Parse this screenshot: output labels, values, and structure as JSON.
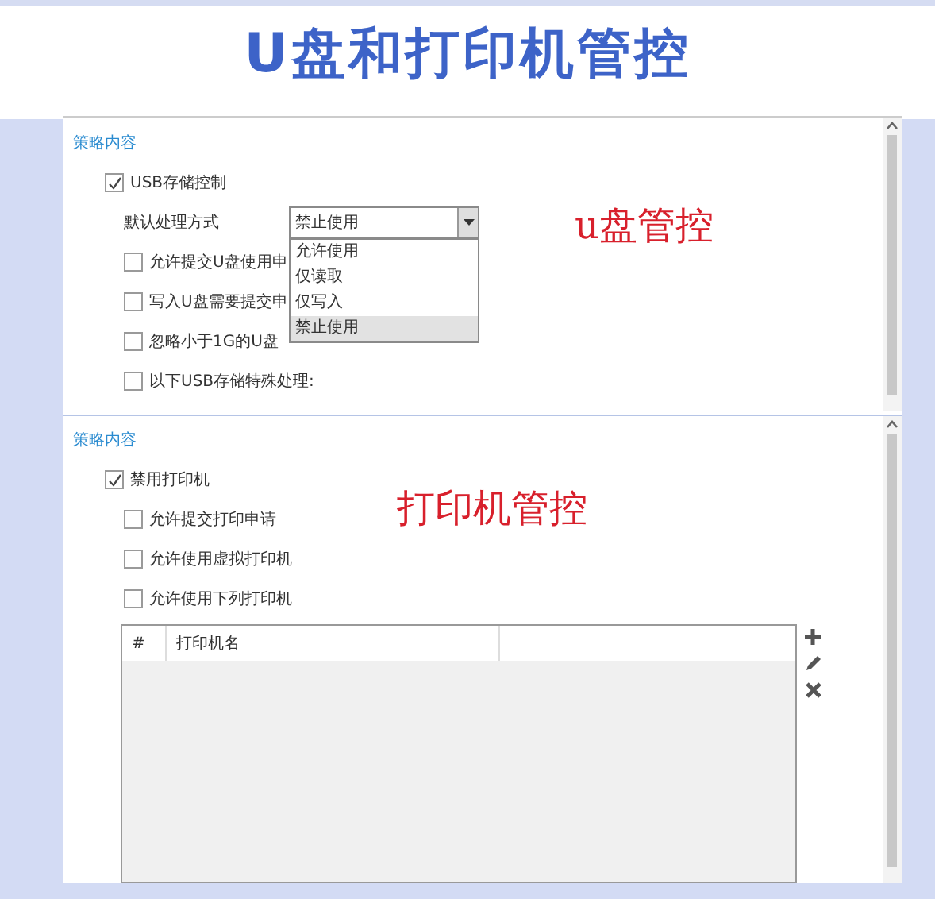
{
  "title": "U盘和打印机管控",
  "usb_panel": {
    "section_title": "策略内容",
    "main_option": {
      "label": "USB存储控制",
      "checked": true
    },
    "default_action": {
      "label": "默认处理方式",
      "value": "禁止使用",
      "expanded": true,
      "options": [
        {
          "label": "允许使用",
          "selected": false
        },
        {
          "label": "仅读取",
          "selected": false
        },
        {
          "label": "仅写入",
          "selected": false
        },
        {
          "label": "禁止使用",
          "selected": true
        }
      ]
    },
    "options": [
      {
        "label": "允许提交U盘使用申",
        "checked": false
      },
      {
        "label": "写入U盘需要提交申",
        "checked": false
      },
      {
        "label": "忽略小于1G的U盘",
        "checked": false
      },
      {
        "label": "以下USB存储特殊处理:",
        "checked": false
      }
    ],
    "annotation": "u盘管控"
  },
  "printer_panel": {
    "section_title": "策略内容",
    "main_option": {
      "label": "禁用打印机",
      "checked": true
    },
    "options": [
      {
        "label": "允许提交打印申请",
        "checked": false
      },
      {
        "label": "允许使用虚拟打印机",
        "checked": false
      },
      {
        "label": "允许使用下列打印机",
        "checked": false
      }
    ],
    "table": {
      "columns": [
        "#",
        "打印机名"
      ]
    },
    "annotation": "打印机管控"
  }
}
